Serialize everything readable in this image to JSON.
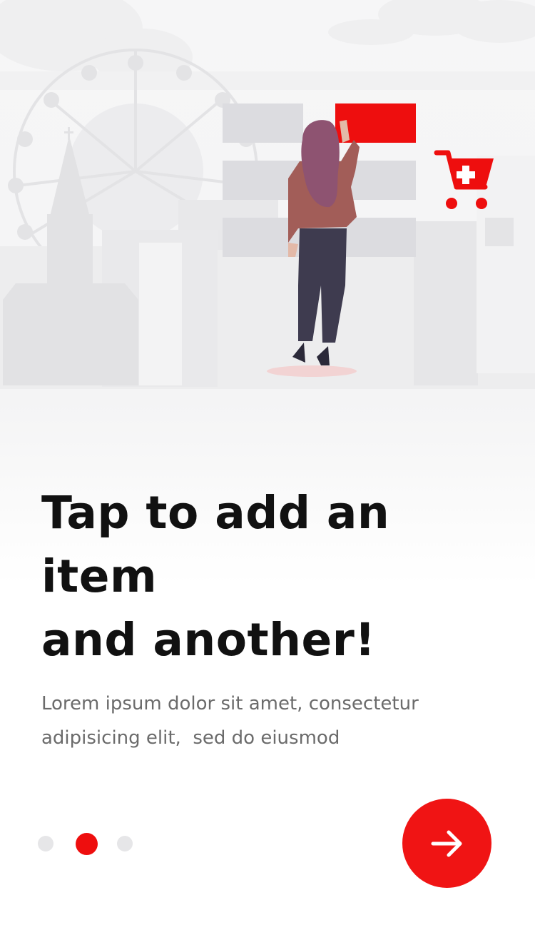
{
  "onboarding": {
    "headline_line1": "Tap to add an",
    "headline_line2": "item",
    "headline_line3": "and another!",
    "description": "Lorem ipsum dolor sit amet, consectetur\nadipisicing elit,  sed do eiusmod",
    "pagination": {
      "total_pages": 3,
      "current_page": 2
    },
    "next_button_icon": "arrow-right-icon",
    "illustration_icons": [
      "woman-figure",
      "add-to-cart-icon",
      "ferris-wheel",
      "church-building",
      "city-buildings"
    ]
  },
  "colors": {
    "accent": "#ee0e0e",
    "headline": "#111111",
    "body": "#6b6b6b",
    "dot_inactive": "#e6e6e8",
    "background": "#ffffff"
  }
}
